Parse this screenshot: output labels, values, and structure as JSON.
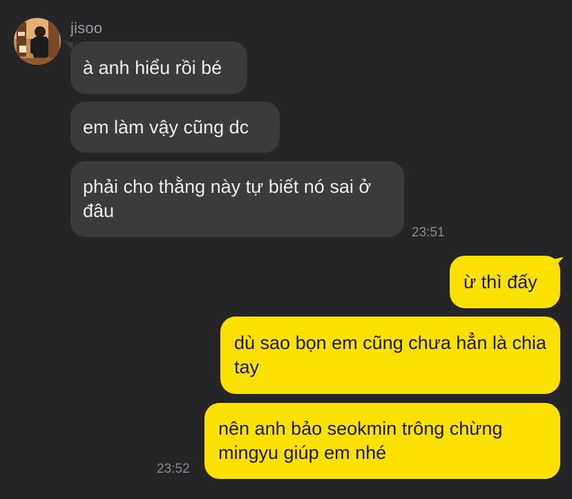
{
  "contact": {
    "name": "jisoo"
  },
  "incoming": [
    {
      "text": "à anh hiểu rồi bé"
    },
    {
      "text": "em làm vậy cũng dc"
    },
    {
      "text": "phải cho thằng này tự biết nó sai ở đâu"
    }
  ],
  "incoming_time": "23:51",
  "outgoing": [
    {
      "text": "ừ thì đấy"
    },
    {
      "text": "dù sao bọn em cũng chưa hẳn là chia tay"
    },
    {
      "text": "nên anh bảo seokmin trông chừng mingyu giúp em nhé"
    }
  ],
  "outgoing_time": "23:52",
  "colors": {
    "background": "#252527",
    "incoming_bubble": "#3b3b3d",
    "outgoing_bubble": "#fae100"
  }
}
